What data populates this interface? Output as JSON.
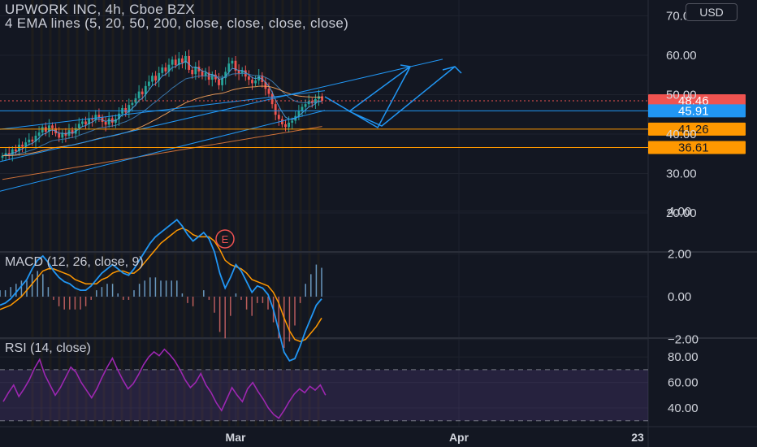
{
  "header": {
    "title": "UPWORK INC, 4h, Cboe BZX",
    "ema_label": "4 EMA lines (5, 20, 50, 200, close, close, close, close)",
    "macd_label": "MACD (12, 26, close, 9)",
    "rsi_label": "RSI (14, close)",
    "currency": "USD",
    "earnings_marker": "E"
  },
  "colors": {
    "background": "#131722",
    "grid": "#1e222d",
    "up": "#26a69a",
    "down": "#ef5350",
    "ema_orange": "#f7a35c",
    "trend_blue": "#2196f3",
    "level_orange": "#ff9800",
    "macd_line": "#2196f3",
    "signal_line": "#ff9800",
    "rsi_line": "#9c27b0",
    "rsi_band": "#7e57c2"
  },
  "chart_data": [
    {
      "type": "candlestick",
      "title": "UPWORK INC, 4h, Cboe BZX",
      "y_ticks": [
        20,
        30,
        40,
        50,
        60,
        70
      ],
      "y_tick_labels": [
        "20.00",
        "30.00",
        "40.00",
        "50.00",
        "60.00",
        "70.00"
      ],
      "x_tick_labels": [
        "Mar",
        "Apr",
        "23"
      ],
      "ylim": [
        12,
        70
      ],
      "price_tags": [
        {
          "value": 48.46,
          "label": "48.46",
          "color": "#ef5350"
        },
        {
          "value": 45.91,
          "label": "45.91",
          "color": "#2196f3"
        },
        {
          "value": 41.26,
          "label": "41.26",
          "color": "#ff9800"
        },
        {
          "value": 36.61,
          "label": "36.61",
          "color": "#ff9800"
        }
      ],
      "closes": [
        34.5,
        35.2,
        34.8,
        36.1,
        35.6,
        37.3,
        36.8,
        37.9,
        38.6,
        38.1,
        39.6,
        40.4,
        41.8,
        40.6,
        42.2,
        41.5,
        40.2,
        39.1,
        40.3,
        39.6,
        41.0,
        40.1,
        41.5,
        42.6,
        43.2,
        42.5,
        44.0,
        43.6,
        44.9,
        44.2,
        43.1,
        42.4,
        44.0,
        42.9,
        43.8,
        45.2,
        46.6,
        45.5,
        47.4,
        47.9,
        49.1,
        50.8,
        50.1,
        52.2,
        53.3,
        54.8,
        53.6,
        55.5,
        56.9,
        55.9,
        57.6,
        58.9,
        57.5,
        59.2,
        58.1,
        59.8,
        56.3,
        55.2,
        57.1,
        55.9,
        54.7,
        55.6,
        53.8,
        55.1,
        53.9,
        52.4,
        54.2,
        55.8,
        57.9,
        58.6,
        56.1,
        55.4,
        56.2,
        54.6,
        53.8,
        52.9,
        53.6,
        54.9,
        53.2,
        51.5,
        50.2,
        47.6,
        44.9,
        43.8,
        42.5,
        41.8,
        42.9,
        43.4,
        44.6,
        45.8,
        46.9,
        47.6,
        48.4,
        47.8,
        48.9,
        49.6,
        48.46
      ]
    },
    {
      "type": "line",
      "title": "MACD (12, 26, close, 9)",
      "y_ticks": [
        -2,
        0,
        2,
        4
      ],
      "y_tick_labels": [
        "−2.00",
        "0.00",
        "2.00",
        "4.00"
      ],
      "ylim": [
        -3.5,
        4
      ],
      "series": [
        {
          "name": "MACD",
          "values": [
            -0.4,
            -0.3,
            -0.1,
            0.2,
            0.5,
            0.8,
            1.3,
            1.7,
            1.9,
            1.6,
            1.2,
            0.9,
            0.7,
            0.6,
            0.4,
            0.3,
            0.3,
            0.5,
            0.8,
            1.1,
            1.3,
            1.5,
            1.3,
            1.1,
            1.0,
            1.3,
            1.7,
            2.1,
            2.5,
            2.8,
            3.0,
            3.2,
            3.4,
            3.6,
            3.3,
            2.9,
            2.6,
            2.8,
            3.0,
            2.7,
            2.1,
            1.1,
            0.4,
            0.9,
            1.5,
            1.2,
            0.7,
            0.2,
            0.5,
            0.4,
            0.1,
            -0.6,
            -1.6,
            -2.6,
            -3.0,
            -2.9,
            -2.3,
            -1.6,
            -1.0,
            -0.4,
            -0.1
          ]
        },
        {
          "name": "Signal",
          "values": [
            -0.6,
            -0.5,
            -0.4,
            -0.2,
            0.0,
            0.3,
            0.6,
            0.9,
            1.2,
            1.3,
            1.3,
            1.2,
            1.1,
            1.0,
            0.8,
            0.7,
            0.6,
            0.6,
            0.6,
            0.8,
            0.9,
            1.1,
            1.2,
            1.2,
            1.1,
            1.1,
            1.3,
            1.6,
            1.9,
            2.2,
            2.5,
            2.7,
            2.9,
            3.1,
            3.2,
            3.1,
            2.9,
            2.8,
            2.8,
            2.8,
            2.6,
            2.2,
            1.7,
            1.5,
            1.4,
            1.3,
            1.1,
            0.8,
            0.7,
            0.6,
            0.5,
            0.2,
            -0.3,
            -1.0,
            -1.6,
            -2.0,
            -2.1,
            -2.0,
            -1.7,
            -1.4,
            -1.0
          ]
        }
      ]
    },
    {
      "type": "line",
      "title": "RSI (14, close)",
      "y_ticks": [
        40,
        60,
        80
      ],
      "y_tick_labels": [
        "40.00",
        "60.00",
        "80.00"
      ],
      "ylim": [
        28,
        95
      ],
      "bands": [
        30,
        70
      ],
      "series": [
        {
          "name": "RSI",
          "values": [
            45,
            52,
            58,
            49,
            55,
            62,
            71,
            78,
            66,
            58,
            50,
            56,
            64,
            72,
            68,
            60,
            54,
            48,
            55,
            64,
            72,
            79,
            70,
            62,
            55,
            59,
            66,
            74,
            80,
            84,
            81,
            86,
            82,
            77,
            70,
            62,
            56,
            60,
            67,
            58,
            52,
            44,
            38,
            47,
            56,
            50,
            45,
            55,
            60,
            53,
            47,
            40,
            35,
            32,
            38,
            45,
            51,
            55,
            52,
            57,
            54,
            58,
            50
          ]
        }
      ]
    }
  ]
}
